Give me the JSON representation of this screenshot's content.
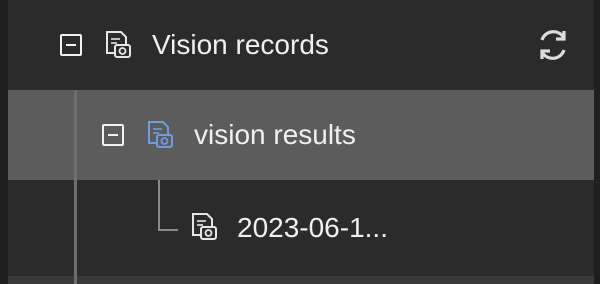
{
  "tree": {
    "root": {
      "label": "Vision records",
      "expanded": true,
      "icon": "record-camera-icon"
    },
    "group": {
      "label": "vision results",
      "expanded": true,
      "selected": true,
      "icon": "record-camera-icon"
    },
    "item": {
      "label": "2023-06-1...",
      "icon": "record-camera-icon"
    }
  },
  "toolbar": {
    "refresh_icon": "refresh-icon"
  },
  "colors": {
    "background": "#2b2b2b",
    "selected_row": "#5c5c5c",
    "text": "#f0f0f0",
    "icon_accent": "#5b8fd6"
  }
}
